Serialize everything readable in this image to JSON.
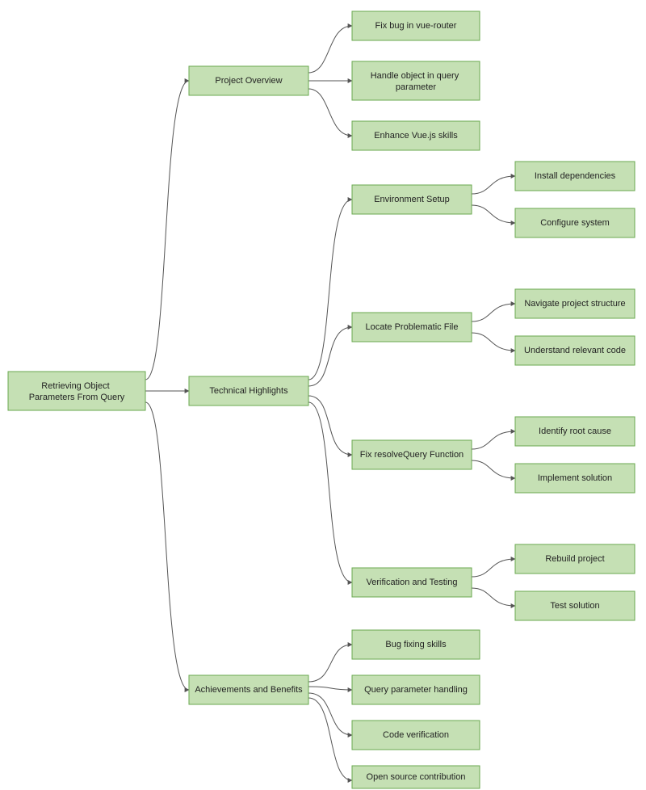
{
  "diagram": {
    "root": {
      "label": "Retrieving Object\nParameters From Query"
    },
    "level1": {
      "overview": {
        "label": "Project Overview"
      },
      "tech": {
        "label": "Technical Highlights"
      },
      "achieve": {
        "label": "Achievements and Benefits"
      }
    },
    "overview_children": {
      "c1": {
        "label": "Fix bug in vue-router"
      },
      "c2": {
        "label": "Handle object in query\nparameter"
      },
      "c3": {
        "label": "Enhance Vue.js skills"
      }
    },
    "tech_children": {
      "env": {
        "label": "Environment Setup"
      },
      "locate": {
        "label": "Locate Problematic File"
      },
      "fix": {
        "label": "Fix resolveQuery Function"
      },
      "verify": {
        "label": "Verification and Testing"
      }
    },
    "env_children": {
      "c1": {
        "label": "Install dependencies"
      },
      "c2": {
        "label": "Configure system"
      }
    },
    "locate_children": {
      "c1": {
        "label": "Navigate project structure"
      },
      "c2": {
        "label": "Understand relevant code"
      }
    },
    "fix_children": {
      "c1": {
        "label": "Identify root cause"
      },
      "c2": {
        "label": "Implement solution"
      }
    },
    "verify_children": {
      "c1": {
        "label": "Rebuild project"
      },
      "c2": {
        "label": "Test solution"
      }
    },
    "achieve_children": {
      "c1": {
        "label": "Bug fixing skills"
      },
      "c2": {
        "label": "Query parameter handling"
      },
      "c3": {
        "label": "Code verification"
      },
      "c4": {
        "label": "Open source contribution"
      }
    }
  },
  "chart_data": {
    "type": "tree",
    "root": "Retrieving Object Parameters From Query",
    "children": [
      {
        "label": "Project Overview",
        "children": [
          {
            "label": "Fix bug in vue-router"
          },
          {
            "label": "Handle object in query parameter"
          },
          {
            "label": "Enhance Vue.js skills"
          }
        ]
      },
      {
        "label": "Technical Highlights",
        "children": [
          {
            "label": "Environment Setup",
            "children": [
              {
                "label": "Install dependencies"
              },
              {
                "label": "Configure system"
              }
            ]
          },
          {
            "label": "Locate Problematic File",
            "children": [
              {
                "label": "Navigate project structure"
              },
              {
                "label": "Understand relevant code"
              }
            ]
          },
          {
            "label": "Fix resolveQuery Function",
            "children": [
              {
                "label": "Identify root cause"
              },
              {
                "label": "Implement solution"
              }
            ]
          },
          {
            "label": "Verification and Testing",
            "children": [
              {
                "label": "Rebuild project"
              },
              {
                "label": "Test solution"
              }
            ]
          }
        ]
      },
      {
        "label": "Achievements and Benefits",
        "children": [
          {
            "label": "Bug fixing skills"
          },
          {
            "label": "Query parameter handling"
          },
          {
            "label": "Code verification"
          },
          {
            "label": "Open source contribution"
          }
        ]
      }
    ]
  }
}
